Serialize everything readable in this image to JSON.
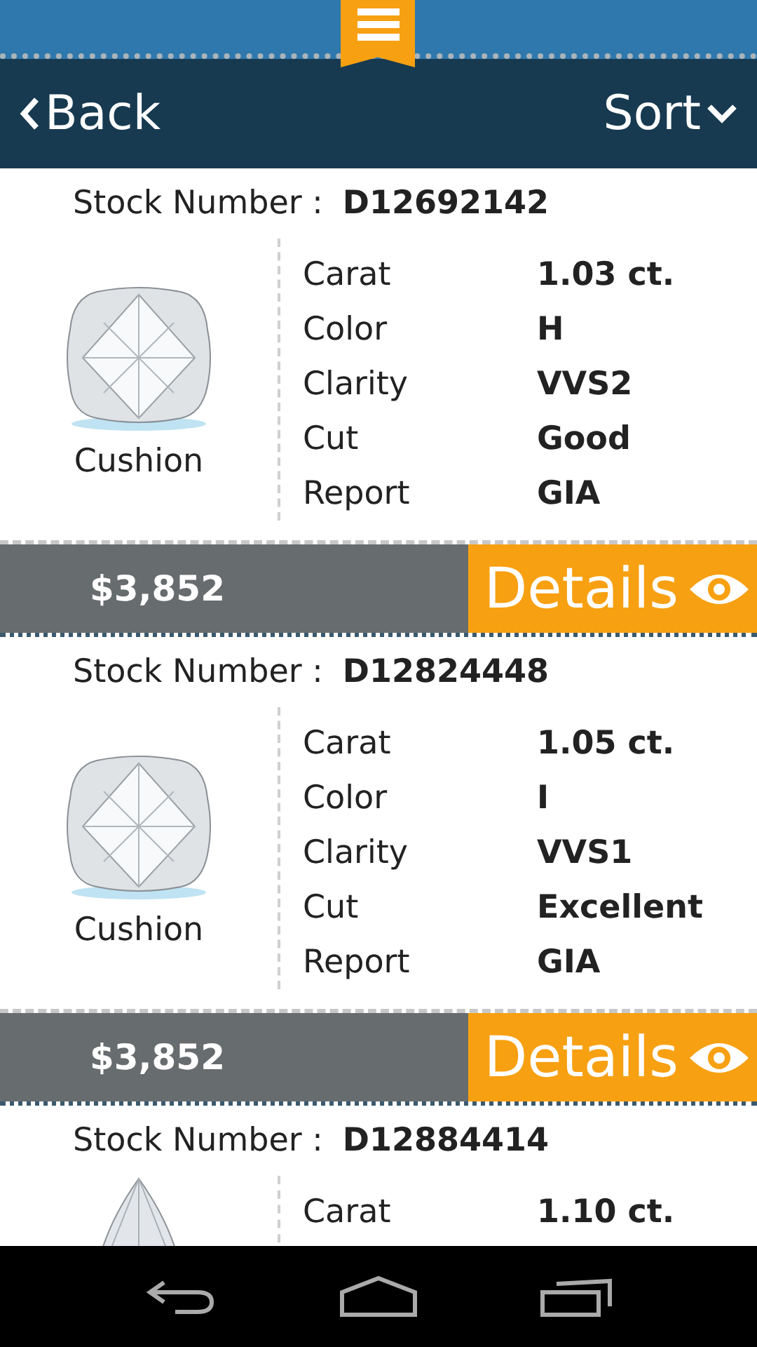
{
  "header": {
    "back": "Back",
    "sort": "Sort"
  },
  "items": [
    {
      "stock_label": "Stock Number :",
      "stock": "D12692142",
      "shape": "Cushion",
      "kind": "cushion",
      "specs": [
        {
          "label": "Carat",
          "value": "1.03 ct."
        },
        {
          "label": "Color",
          "value": "H"
        },
        {
          "label": "Clarity",
          "value": "VVS2"
        },
        {
          "label": "Cut",
          "value": "Good"
        },
        {
          "label": "Report",
          "value": "GIA"
        }
      ],
      "price": "$3,852",
      "details": "Details"
    },
    {
      "stock_label": "Stock Number :",
      "stock": "D12824448",
      "shape": "Cushion",
      "kind": "cushion",
      "specs": [
        {
          "label": "Carat",
          "value": "1.05 ct."
        },
        {
          "label": "Color",
          "value": "I"
        },
        {
          "label": "Clarity",
          "value": "VVS1"
        },
        {
          "label": "Cut",
          "value": "Excellent"
        },
        {
          "label": "Report",
          "value": "GIA"
        }
      ],
      "price": "$3,852",
      "details": "Details"
    },
    {
      "stock_label": "Stock Number :",
      "stock": "D12884414",
      "kind": "pear",
      "specs": [
        {
          "label": "Carat",
          "value": "1.10 ct."
        }
      ]
    }
  ]
}
